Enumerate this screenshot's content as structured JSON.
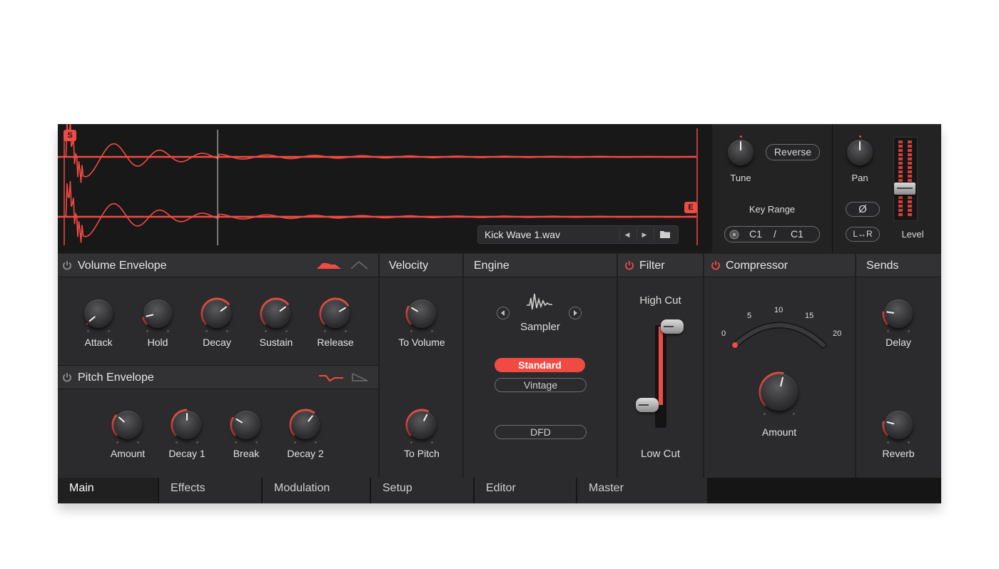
{
  "waveform": {
    "start_marker": "S",
    "end_marker": "E",
    "file_name": "Kick Wave 1.wav",
    "prev_icon": "prev-icon",
    "next_icon": "next-icon",
    "folder_icon": "folder-icon"
  },
  "tune": {
    "label": "Tune",
    "reverse_label": "Reverse"
  },
  "key_range": {
    "label": "Key Range",
    "low": "C1",
    "separator": "/",
    "high": "C1"
  },
  "output": {
    "pan_label": "Pan",
    "phase_label": "Ø",
    "stereo_label": "L↔R",
    "level_label": "Level"
  },
  "volume_envelope": {
    "title": "Volume Envelope",
    "knobs": [
      {
        "label": "Attack",
        "value": 0.02
      },
      {
        "label": "Hold",
        "value": 0.12
      },
      {
        "label": "Decay",
        "value": 0.7
      },
      {
        "label": "Sustain",
        "value": 0.7
      },
      {
        "label": "Release",
        "value": 0.72
      }
    ]
  },
  "pitch_envelope": {
    "title": "Pitch Envelope",
    "knobs": [
      {
        "label": "Amount",
        "value": 0.32
      },
      {
        "label": "Decay 1",
        "value": 0.5
      },
      {
        "label": "Break",
        "value": 0.28
      },
      {
        "label": "Decay 2",
        "value": 0.64
      }
    ]
  },
  "velocity": {
    "title": "Velocity",
    "knobs": [
      {
        "label": "To Volume",
        "value": 0.28
      },
      {
        "label": "To Pitch",
        "value": 0.6
      }
    ]
  },
  "engine": {
    "title": "Engine",
    "type_label": "Sampler",
    "modes": [
      "Standard",
      "Vintage"
    ],
    "active_mode": "Standard",
    "dfd_label": "DFD"
  },
  "filter": {
    "title": "Filter",
    "high_label": "High Cut",
    "low_label": "Low Cut",
    "enabled": true
  },
  "compressor": {
    "title": "Compressor",
    "scale": [
      "0",
      "5",
      "10",
      "15",
      "20"
    ],
    "amount_label": "Amount",
    "amount_value": 0.55,
    "enabled": true
  },
  "sends": {
    "title": "Sends",
    "knobs": [
      {
        "label": "Delay",
        "value": 0.2
      },
      {
        "label": "Reverb",
        "value": 0.22
      }
    ]
  },
  "tabs": [
    "Main",
    "Effects",
    "Modulation",
    "Setup",
    "Editor",
    "Master"
  ],
  "active_tab": "Main",
  "colors": {
    "accent": "#ef4b43",
    "panel": "#2b2b2d",
    "background": "#1f1f20"
  }
}
